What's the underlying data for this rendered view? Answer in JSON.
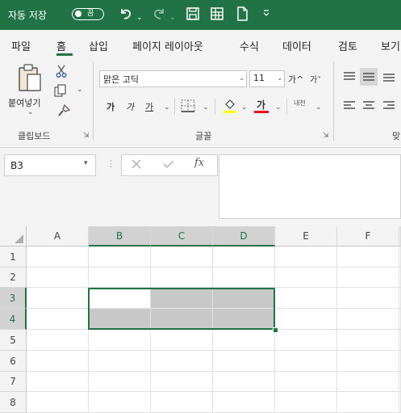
{
  "titlebar": {
    "autosave_label": "자동 저장",
    "autosave_toggle": "끔",
    "quick_access_icons": [
      "undo-icon",
      "redo-icon",
      "save-icon",
      "form-icon",
      "new-file-icon",
      "customize-icon"
    ]
  },
  "tabs": [
    "파일",
    "홈",
    "삽입",
    "페이지 레이아웃",
    "수식",
    "데이터",
    "검토",
    "보기"
  ],
  "active_tab": "홈",
  "ribbon": {
    "clipboard": {
      "group_label": "클립보드",
      "paste_label": "붙여넣기"
    },
    "font": {
      "group_label": "글꼴",
      "font_name": "맑은 고딕",
      "font_size": "11",
      "bold": "가",
      "italic": "가",
      "underline": "가",
      "font_color_letter": "가",
      "phonetic": "내천",
      "grow_font": "가^",
      "shrink_font": "가ˇ"
    },
    "alignment": {
      "group_label": "맞"
    }
  },
  "formula_bar": {
    "name_box": "B3",
    "formula": ""
  },
  "grid": {
    "columns": [
      "A",
      "B",
      "C",
      "D",
      "E",
      "F"
    ],
    "rows": [
      "1",
      "2",
      "3",
      "4",
      "5",
      "6",
      "7",
      "8"
    ],
    "selected_range": "B3:D4",
    "selected_columns": [
      "B",
      "C",
      "D"
    ],
    "selected_rows": [
      "3",
      "4"
    ]
  },
  "colors": {
    "accent": "#217346",
    "selection_fill": "#c8c8c8",
    "font_color_bar": "#e81123",
    "highlight_bar": "#ffff00"
  }
}
